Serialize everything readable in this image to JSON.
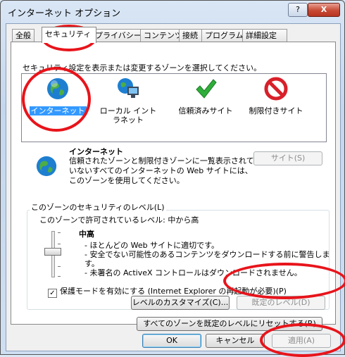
{
  "window": {
    "title": "インターネット オプション",
    "help_label": "?",
    "close_label": "X"
  },
  "tabs": [
    {
      "label": "全般"
    },
    {
      "label": "セキュリティ"
    },
    {
      "label": "プライバシー"
    },
    {
      "label": "コンテンツ"
    },
    {
      "label": "接続"
    },
    {
      "label": "プログラム"
    },
    {
      "label": "詳細設定"
    }
  ],
  "security": {
    "zone_heading": "セキュリティ設定を表示または変更するゾーンを選択してください。",
    "zones": [
      {
        "label": "インターネット",
        "icon": "globe-icon"
      },
      {
        "label": "ローカル イントラネット",
        "icon": "intranet-icon"
      },
      {
        "label": "信頼済みサイト",
        "icon": "checkmark-icon"
      },
      {
        "label": "制限付きサイト",
        "icon": "no-entry-icon"
      }
    ],
    "selected_zone": "インターネット",
    "detail_title": "インターネット",
    "detail_desc": "信頼されたゾーンと制限付きゾーンに一覧表示されていないすべてのインターネットの Web サイトには、このゾーンを使用してください。",
    "sites_label": "サイト(S)",
    "level_group_label": "このゾーンのセキュリティのレベル(L)",
    "allowed_levels": "このゾーンで許可されているレベル: 中から高",
    "level_name": "中高",
    "level_desc": [
      "- ほとんどの Web サイトに適切です。",
      "- 安全でない可能性のあるコンテンツをダウンロードする前に警告します。",
      "- 未署名の ActiveX コントロールはダウンロードされません。"
    ],
    "protected_mode_label": "保護モードを有効にする (Internet Explorer の再起動が必要)(P)",
    "protected_mode_checked": true,
    "custom_level_label": "レベルのカスタマイズ(C)...",
    "default_level_label": "既定のレベル(D)",
    "reset_all_label": "すべてのゾーンを既定のレベルにリセットする(R)"
  },
  "buttons": {
    "ok": "OK",
    "cancel": "キャンセル",
    "apply": "適用(A)"
  },
  "colors": {
    "selection": "#3399ff",
    "annotation": "#e8141b",
    "globe": "#1e7fd0",
    "check": "#2fae3a",
    "no_entry": "#d8202a"
  }
}
